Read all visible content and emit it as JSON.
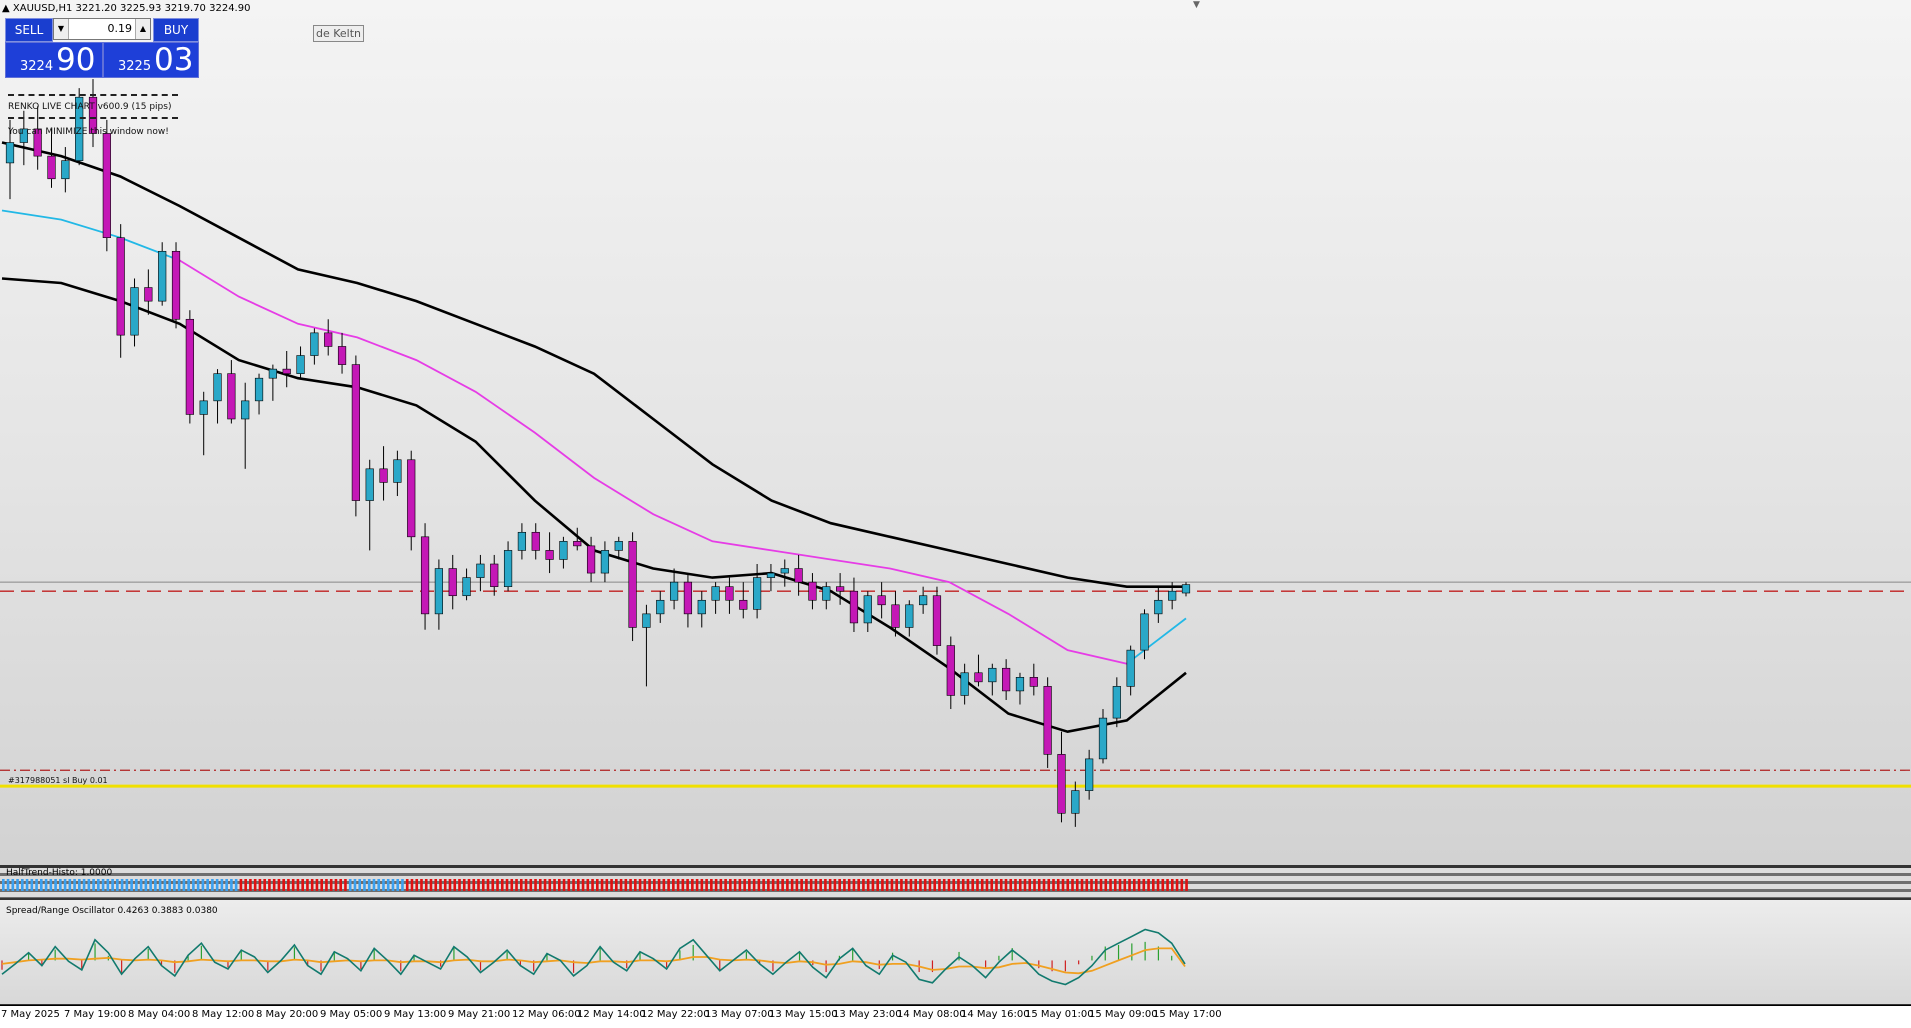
{
  "header": {
    "symbol_info": "XAUUSD,H1  3221.20 3225.93 3219.70 3224.90"
  },
  "trade_panel": {
    "sell_label": "SELL",
    "buy_label": "BUY",
    "lot_value": "0.19",
    "sell_price_small": "3224",
    "sell_price_big": "90",
    "buy_price_small": "3225",
    "buy_price_big": "03"
  },
  "keltner_button": "de Keltn",
  "renko": {
    "title": "RENKO LIVE CHART v600.9 (15 pips)",
    "note": "You can MINIMIZE this window now!"
  },
  "order_label": "#317988051 sl Buy 0.01",
  "halftrend_label": "HalfTrend-Histo: 1.0000",
  "oscillator_label": "Spread/Range Oscillator 0.4263 0.3883 0.0380",
  "colors": {
    "bull_body": "#2aa8c8",
    "bear_body": "#c418b6",
    "mid_band": "#e63ce6",
    "outer_band": "#000000",
    "cyan_band": "#22b8e6",
    "osc_teal": "#127a6e",
    "osc_orange": "#f0a020",
    "yellow_line": "#f0e000",
    "dashed_red": "#c02020",
    "histo_blue": "#3aa0f0",
    "histo_red": "#e01010"
  },
  "chart_data": {
    "type": "candlestick",
    "symbol": "XAUUSD",
    "timeframe": "H1",
    "ohlc_current": {
      "open": 3221.2,
      "high": 3225.93,
      "low": 3219.7,
      "close": 3224.9
    },
    "x_tick_labels": [
      "7 May 2025",
      "7 May 19:00",
      "8 May 04:00",
      "8 May 12:00",
      "8 May 20:00",
      "9 May 05:00",
      "9 May 13:00",
      "9 May 21:00",
      "12 May 06:00",
      "12 May 14:00",
      "12 May 22:00",
      "13 May 07:00",
      "13 May 15:00",
      "13 May 23:00",
      "14 May 08:00",
      "14 May 16:00",
      "15 May 01:00",
      "15 May 09:00",
      "15 May 17:00"
    ],
    "candles": [
      [
        3411,
        3430,
        3395,
        3420
      ],
      [
        3420,
        3434,
        3410,
        3426
      ],
      [
        3426,
        3436,
        3408,
        3414
      ],
      [
        3414,
        3426,
        3400,
        3404
      ],
      [
        3404,
        3418,
        3398,
        3412
      ],
      [
        3412,
        3444,
        3410,
        3440
      ],
      [
        3440,
        3448,
        3418,
        3424
      ],
      [
        3424,
        3430,
        3372,
        3378
      ],
      [
        3378,
        3384,
        3325,
        3335
      ],
      [
        3335,
        3360,
        3330,
        3356
      ],
      [
        3356,
        3364,
        3344,
        3350
      ],
      [
        3350,
        3376,
        3348,
        3372
      ],
      [
        3372,
        3376,
        3338,
        3342
      ],
      [
        3342,
        3346,
        3296,
        3300
      ],
      [
        3300,
        3310,
        3282,
        3306
      ],
      [
        3306,
        3320,
        3296,
        3318
      ],
      [
        3318,
        3324,
        3296,
        3298
      ],
      [
        3298,
        3314,
        3276,
        3306
      ],
      [
        3306,
        3318,
        3300,
        3316
      ],
      [
        3316,
        3322,
        3306,
        3320
      ],
      [
        3320,
        3328,
        3312,
        3318
      ],
      [
        3318,
        3330,
        3316,
        3326
      ],
      [
        3326,
        3338,
        3322,
        3336
      ],
      [
        3336,
        3342,
        3326,
        3330
      ],
      [
        3330,
        3336,
        3318,
        3322
      ],
      [
        3322,
        3326,
        3255,
        3262
      ],
      [
        3262,
        3280,
        3240,
        3276
      ],
      [
        3276,
        3286,
        3262,
        3270
      ],
      [
        3270,
        3284,
        3264,
        3280
      ],
      [
        3280,
        3284,
        3240,
        3246
      ],
      [
        3246,
        3252,
        3205,
        3212
      ],
      [
        3212,
        3236,
        3205,
        3232
      ],
      [
        3232,
        3238,
        3214,
        3220
      ],
      [
        3220,
        3232,
        3218,
        3228
      ],
      [
        3228,
        3238,
        3222,
        3234
      ],
      [
        3234,
        3238,
        3220,
        3224
      ],
      [
        3224,
        3244,
        3222,
        3240
      ],
      [
        3240,
        3252,
        3236,
        3248
      ],
      [
        3248,
        3252,
        3236,
        3240
      ],
      [
        3240,
        3248,
        3230,
        3236
      ],
      [
        3236,
        3246,
        3232,
        3244
      ],
      [
        3244,
        3250,
        3240,
        3242
      ],
      [
        3242,
        3246,
        3226,
        3230
      ],
      [
        3230,
        3244,
        3226,
        3240
      ],
      [
        3240,
        3246,
        3236,
        3244
      ],
      [
        3244,
        3248,
        3200,
        3206
      ],
      [
        3206,
        3216,
        3180,
        3212
      ],
      [
        3212,
        3222,
        3208,
        3218
      ],
      [
        3218,
        3232,
        3214,
        3226
      ],
      [
        3226,
        3230,
        3206,
        3212
      ],
      [
        3212,
        3222,
        3206,
        3218
      ],
      [
        3218,
        3226,
        3212,
        3224
      ],
      [
        3224,
        3228,
        3212,
        3218
      ],
      [
        3218,
        3226,
        3210,
        3214
      ],
      [
        3214,
        3234,
        3210,
        3228
      ],
      [
        3228,
        3234,
        3222,
        3230
      ],
      [
        3230,
        3236,
        3224,
        3232
      ],
      [
        3232,
        3238,
        3220,
        3226
      ],
      [
        3226,
        3230,
        3214,
        3218
      ],
      [
        3218,
        3226,
        3214,
        3224
      ],
      [
        3224,
        3230,
        3216,
        3222
      ],
      [
        3222,
        3228,
        3204,
        3208
      ],
      [
        3208,
        3222,
        3204,
        3220
      ],
      [
        3220,
        3226,
        3210,
        3216
      ],
      [
        3216,
        3222,
        3202,
        3206
      ],
      [
        3206,
        3218,
        3202,
        3216
      ],
      [
        3216,
        3224,
        3212,
        3220
      ],
      [
        3220,
        3224,
        3194,
        3198
      ],
      [
        3198,
        3202,
        3170,
        3176
      ],
      [
        3176,
        3190,
        3172,
        3186
      ],
      [
        3186,
        3194,
        3180,
        3182
      ],
      [
        3182,
        3190,
        3176,
        3188
      ],
      [
        3188,
        3192,
        3174,
        3178
      ],
      [
        3178,
        3186,
        3172,
        3184
      ],
      [
        3184,
        3190,
        3176,
        3180
      ],
      [
        3180,
        3184,
        3144,
        3150
      ],
      [
        3150,
        3160,
        3120,
        3124
      ],
      [
        3124,
        3138,
        3118,
        3134
      ],
      [
        3134,
        3152,
        3130,
        3148
      ],
      [
        3148,
        3170,
        3146,
        3166
      ],
      [
        3166,
        3184,
        3162,
        3180
      ],
      [
        3180,
        3198,
        3176,
        3196
      ],
      [
        3196,
        3214,
        3192,
        3212
      ],
      [
        3212,
        3224,
        3208,
        3218
      ],
      [
        3218,
        3226,
        3214,
        3222
      ],
      [
        3221.2,
        3225.93,
        3219.7,
        3224.9
      ]
    ],
    "price_levels": {
      "current_line": 3226,
      "dashed_red_line": 3222,
      "order_line": 3143,
      "yellow_line": 3136
    },
    "bands": {
      "upper": [
        3420,
        3414,
        3405,
        3392,
        3378,
        3364,
        3358,
        3350,
        3340,
        3330,
        3318,
        3298,
        3278,
        3262,
        3252,
        3246,
        3240,
        3234,
        3228,
        3224,
        3224
      ],
      "middle": [
        3390,
        3386,
        3378,
        3368,
        3352,
        3340,
        3334,
        3324,
        3310,
        3292,
        3272,
        3256,
        3244,
        3240,
        3236,
        3232,
        3226,
        3212,
        3196,
        3190,
        3210
      ],
      "lower": [
        3360,
        3358,
        3350,
        3340,
        3324,
        3316,
        3312,
        3304,
        3288,
        3262,
        3240,
        3232,
        3228,
        3230,
        3222,
        3206,
        3188,
        3168,
        3160,
        3165,
        3186
      ]
    },
    "halftrend": [
      1,
      1,
      1,
      1,
      1,
      1,
      1,
      1,
      1,
      1,
      1,
      1,
      1,
      1,
      1,
      1,
      1,
      1,
      1,
      1,
      1,
      1,
      1,
      1,
      1,
      1,
      1,
      1,
      1,
      1,
      1,
      1,
      1,
      1,
      1,
      1,
      1,
      1,
      1,
      1,
      1,
      1,
      1,
      1,
      1,
      1,
      1,
      1,
      1,
      1,
      1,
      1,
      1,
      1,
      1,
      1,
      1,
      1,
      1,
      1,
      1,
      1,
      1,
      1,
      1,
      1,
      1,
      1,
      1,
      1,
      1,
      1,
      1,
      1,
      1,
      1,
      1,
      1,
      1,
      1,
      1,
      1,
      1,
      1,
      1,
      1
    ],
    "oscillator": {
      "current": [
        0.4263,
        0.3883,
        0.038
      ],
      "fast": [
        0.3,
        0.42,
        0.55,
        0.4,
        0.62,
        0.45,
        0.35,
        0.7,
        0.55,
        0.3,
        0.48,
        0.62,
        0.4,
        0.28,
        0.52,
        0.66,
        0.44,
        0.36,
        0.58,
        0.5,
        0.32,
        0.46,
        0.64,
        0.4,
        0.3,
        0.56,
        0.48,
        0.34,
        0.6,
        0.46,
        0.3,
        0.52,
        0.44,
        0.36,
        0.62,
        0.5,
        0.32,
        0.44,
        0.58,
        0.4,
        0.3,
        0.54,
        0.46,
        0.28,
        0.4,
        0.62,
        0.44,
        0.34,
        0.56,
        0.48,
        0.36,
        0.6,
        0.7,
        0.52,
        0.34,
        0.46,
        0.58,
        0.42,
        0.3,
        0.44,
        0.56,
        0.38,
        0.26,
        0.48,
        0.6,
        0.4,
        0.3,
        0.52,
        0.44,
        0.24,
        0.2,
        0.36,
        0.5,
        0.4,
        0.26,
        0.44,
        0.58,
        0.46,
        0.3,
        0.22,
        0.18,
        0.26,
        0.4,
        0.58,
        0.66,
        0.74,
        0.82,
        0.78,
        0.66,
        0.42
      ],
      "slow": [
        0.42,
        0.44,
        0.46,
        0.47,
        0.48,
        0.48,
        0.47,
        0.48,
        0.49,
        0.47,
        0.46,
        0.47,
        0.46,
        0.44,
        0.45,
        0.47,
        0.46,
        0.45,
        0.46,
        0.46,
        0.45,
        0.45,
        0.47,
        0.46,
        0.44,
        0.45,
        0.46,
        0.45,
        0.46,
        0.46,
        0.44,
        0.45,
        0.45,
        0.44,
        0.46,
        0.47,
        0.45,
        0.45,
        0.47,
        0.46,
        0.44,
        0.45,
        0.46,
        0.44,
        0.43,
        0.45,
        0.45,
        0.44,
        0.46,
        0.46,
        0.45,
        0.47,
        0.5,
        0.5,
        0.47,
        0.46,
        0.47,
        0.46,
        0.44,
        0.43,
        0.45,
        0.44,
        0.41,
        0.42,
        0.45,
        0.44,
        0.41,
        0.42,
        0.42,
        0.39,
        0.35,
        0.36,
        0.39,
        0.39,
        0.37,
        0.38,
        0.42,
        0.43,
        0.4,
        0.36,
        0.32,
        0.31,
        0.34,
        0.4,
        0.46,
        0.52,
        0.58,
        0.6,
        0.6,
        0.39
      ]
    }
  }
}
